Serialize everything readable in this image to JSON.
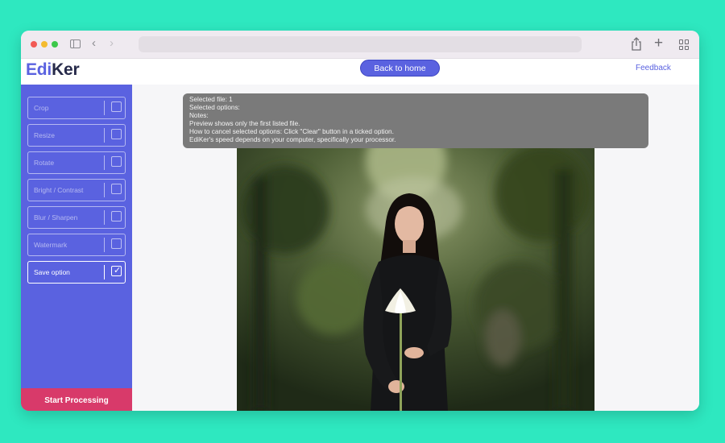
{
  "app": {
    "logo_part1": "Edi",
    "logo_part2": "Ker",
    "back_home_label": "Back to home",
    "feedback_label": "Feedback"
  },
  "sidebar": {
    "options": [
      {
        "label": "Crop",
        "checked": false
      },
      {
        "label": "Resize",
        "checked": false
      },
      {
        "label": "Rotate",
        "checked": false
      },
      {
        "label": "Bright / Contrast",
        "checked": false
      },
      {
        "label": "Blur / Sharpen",
        "checked": false
      },
      {
        "label": "Watermark",
        "checked": false
      },
      {
        "label": "Save option",
        "checked": true
      }
    ],
    "start_label": "Start Processing"
  },
  "info": {
    "lines": [
      "Selected file: 1",
      "Selected options:",
      "Notes:",
      "Preview shows only the first listed file.",
      "How to cancel selected options: Click \"Clear\" button in a ticked option.",
      "EdiKer's speed depends on your computer, specifically your processor."
    ]
  },
  "colors": {
    "accent": "#5a62e0",
    "start_button": "#d83a6a",
    "background": "#2ee8c0",
    "info_box": "#7a7a7a"
  },
  "icons": {
    "back": "chevron-left-icon",
    "forward": "chevron-right-icon",
    "share": "share-icon",
    "new_tab": "plus-icon",
    "tabs": "tab-overview-icon",
    "checked": "checkmark-icon"
  }
}
